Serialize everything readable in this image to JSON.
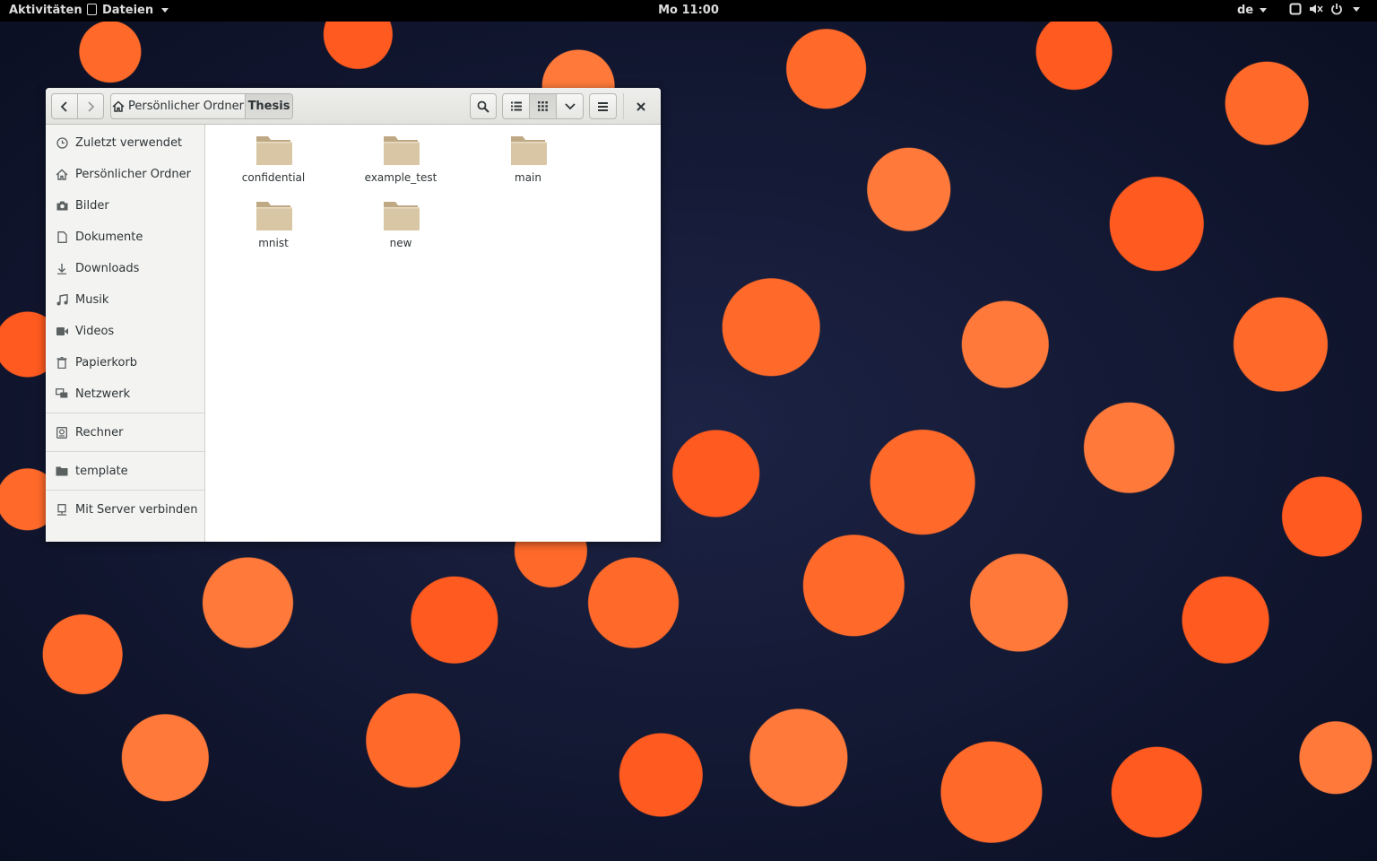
{
  "topbar": {
    "activities": "Aktivitäten",
    "app_name": "Dateien",
    "clock": "Mo 11:00",
    "language": "de"
  },
  "window": {
    "path": {
      "home_label": "Persönlicher Ordner",
      "current_label": "Thesis"
    },
    "sidebar": {
      "recent": "Zuletzt verwendet",
      "home": "Persönlicher Ordner",
      "pictures": "Bilder",
      "documents": "Dokumente",
      "downloads": "Downloads",
      "music": "Musik",
      "videos": "Videos",
      "trash": "Papierkorb",
      "network": "Netzwerk",
      "computer": "Rechner",
      "template": "template",
      "connect_server": "Mit Server verbinden"
    },
    "files": [
      {
        "name": "confidential"
      },
      {
        "name": "example_test"
      },
      {
        "name": "main"
      },
      {
        "name": "mnist"
      },
      {
        "name": "new"
      }
    ]
  },
  "colors": {
    "folder": "#d8c6a5",
    "folder_dark": "#bfa985",
    "topbar_bg": "#000000",
    "headerbar_bg": "#e8e8e7"
  }
}
